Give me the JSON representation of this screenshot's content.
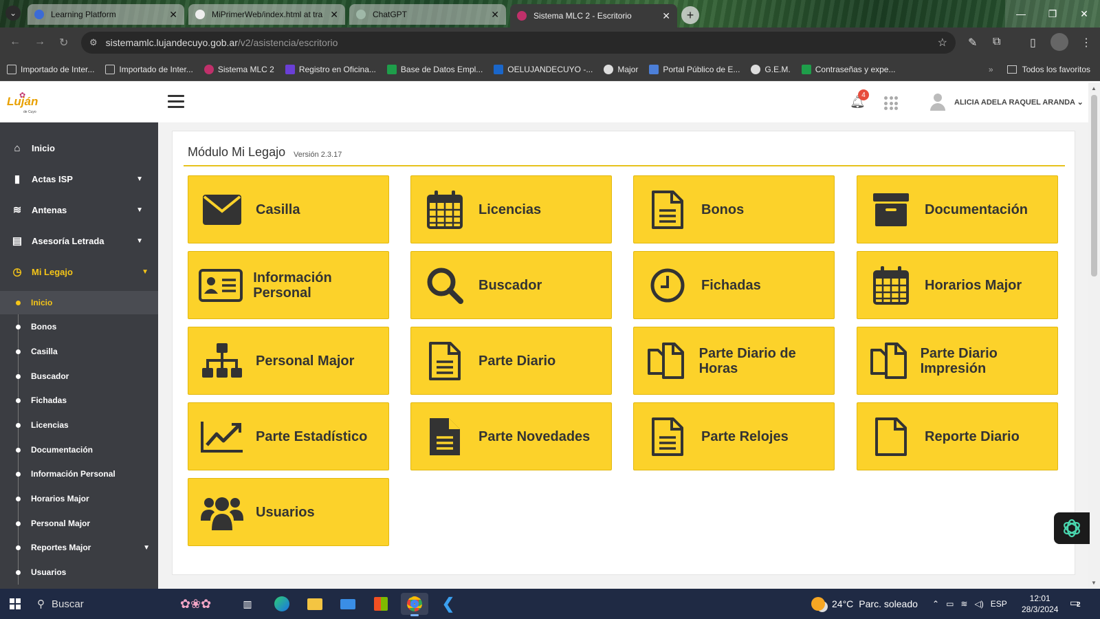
{
  "browser": {
    "tabs": [
      {
        "title": "Learning Platform",
        "color": "#3b6bd6"
      },
      {
        "title": "MiPrimerWeb/index.html at tra",
        "color": "#eeeeee"
      },
      {
        "title": "ChatGPT",
        "color": "#9fb8a8"
      },
      {
        "title": "Sistema MLC 2 - Escritorio",
        "color": "#c0306a"
      }
    ],
    "url_host": "sistemamlc.lujandecuyo.gob.ar",
    "url_path": "/v2/asistencia/escritorio",
    "bookmarks": [
      {
        "label": "Importado de Inter...",
        "icon": "folder-icon",
        "color": "#cccccc"
      },
      {
        "label": "Importado de Inter...",
        "icon": "folder-icon",
        "color": "#cccccc"
      },
      {
        "label": "Sistema MLC 2",
        "icon": "flower-icon",
        "color": "#c0306a"
      },
      {
        "label": "Registro en Oficina...",
        "icon": "form-icon",
        "color": "#6a3fd6"
      },
      {
        "label": "Base de Datos Empl...",
        "icon": "sheet-icon",
        "color": "#1e9e4a"
      },
      {
        "label": "OELUJANDECUYO -...",
        "icon": "outlook-icon",
        "color": "#1a66c9"
      },
      {
        "label": "Major",
        "icon": "globe-icon",
        "color": "#dddddd"
      },
      {
        "label": "Portal Público de E...",
        "icon": "doc-icon",
        "color": "#4c7fd8"
      },
      {
        "label": "G.E.M.",
        "icon": "google-icon",
        "color": "#dddddd"
      },
      {
        "label": "Contraseñas y expe...",
        "icon": "sheet-icon",
        "color": "#1e9e4a"
      }
    ],
    "all_bookmarks": "Todos los favoritos"
  },
  "header": {
    "logo_text": "Luján",
    "logo_sub": "de Cuyo",
    "notification_count": "4",
    "user_name": "ALICIA ADELA RAQUEL ARANDA"
  },
  "sidebar": {
    "items": [
      {
        "label": "Inicio",
        "icon": "home-icon"
      },
      {
        "label": "Actas ISP",
        "icon": "file-icon"
      },
      {
        "label": "Antenas",
        "icon": "wifi-icon"
      },
      {
        "label": "Asesoría Letrada",
        "icon": "book-icon"
      },
      {
        "label": "Mi Legajo",
        "icon": "clock-icon"
      }
    ],
    "sub_items": [
      "Inicio",
      "Bonos",
      "Casilla",
      "Buscador",
      "Fichadas",
      "Licencias",
      "Documentación",
      "Información Personal",
      "Horarios Major",
      "Personal Major",
      "Reportes Major",
      "Usuarios"
    ]
  },
  "module": {
    "title": "Módulo Mi Legajo",
    "version": "Versión 2.3.17"
  },
  "tiles": [
    {
      "label": "Casilla",
      "icon": "envelope-icon"
    },
    {
      "label": "Licencias",
      "icon": "calendar-icon"
    },
    {
      "label": "Bonos",
      "icon": "document-icon"
    },
    {
      "label": "Documentación",
      "icon": "archive-icon"
    },
    {
      "label": "Información Personal",
      "icon": "id-card-icon"
    },
    {
      "label": "Buscador",
      "icon": "search-icon"
    },
    {
      "label": "Fichadas",
      "icon": "clock-icon"
    },
    {
      "label": "Horarios Major",
      "icon": "calendar-icon"
    },
    {
      "label": "Personal Major",
      "icon": "sitemap-icon"
    },
    {
      "label": "Parte Diario",
      "icon": "document-icon"
    },
    {
      "label": "Parte Diario de Horas",
      "icon": "copy-icon"
    },
    {
      "label": "Parte Diario Impresión",
      "icon": "copy-icon"
    },
    {
      "label": "Parte Estadístico",
      "icon": "line-chart-icon"
    },
    {
      "label": "Parte Novedades",
      "icon": "document-solid-icon"
    },
    {
      "label": "Parte Relojes",
      "icon": "document-icon"
    },
    {
      "label": "Reporte Diario",
      "icon": "blank-file-icon"
    },
    {
      "label": "Usuarios",
      "icon": "users-icon"
    }
  ],
  "taskbar": {
    "search_label": "Buscar",
    "temperature": "24°C",
    "condition": "Parc. soleado",
    "language": "ESP",
    "time": "12:01",
    "date": "28/3/2024",
    "notifications": "2"
  }
}
